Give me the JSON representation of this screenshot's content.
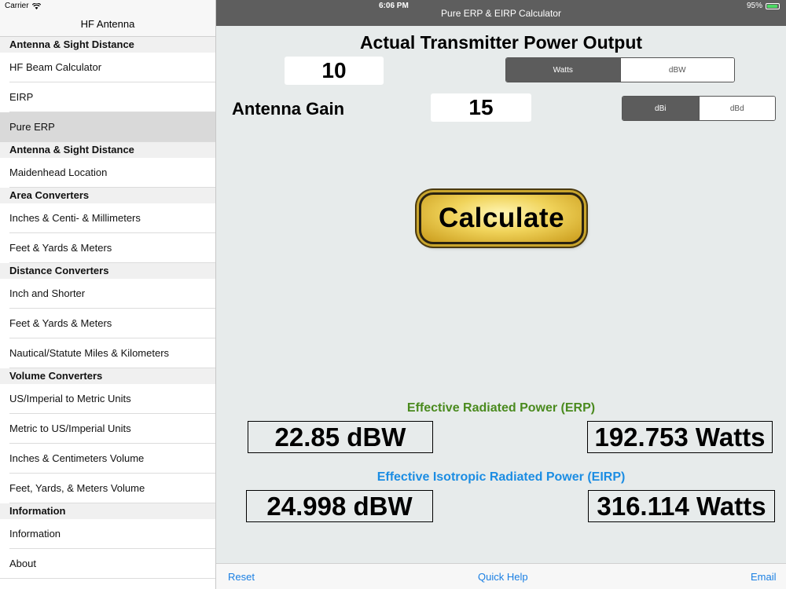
{
  "status": {
    "carrier": "Carrier",
    "time": "6:06 PM",
    "battery": "95%"
  },
  "sidebar": {
    "title": "HF Antenna",
    "sections": [
      {
        "header": "Antenna & Sight Distance",
        "items": [
          "HF Beam Calculator",
          "EIRP",
          "Pure ERP"
        ]
      },
      {
        "header": "Antenna & Sight Distance",
        "items": [
          "Maidenhead Location"
        ]
      },
      {
        "header": "Area Converters",
        "items": [
          "Inches & Centi- & Millimeters",
          "Feet & Yards & Meters"
        ]
      },
      {
        "header": "Distance Converters",
        "items": [
          "Inch and Shorter",
          "Feet & Yards & Meters",
          "Nautical/Statute Miles & Kilometers"
        ]
      },
      {
        "header": "Volume Converters",
        "items": [
          "US/Imperial to Metric Units",
          "Metric to US/Imperial Units",
          "Inches & Centimeters Volume",
          "Feet, Yards, & Meters Volume"
        ]
      },
      {
        "header": "Information",
        "items": [
          "Information",
          "About"
        ]
      }
    ],
    "selected": "Pure ERP"
  },
  "header": {
    "title": "Pure ERP & EIRP Calculator"
  },
  "form": {
    "power_title": "Actual Transmitter Power Output",
    "power_value": "10",
    "power_units": [
      "Watts",
      "dBW"
    ],
    "gain_label": "Antenna Gain",
    "gain_value": "15",
    "gain_units": [
      "dBi",
      "dBd"
    ],
    "calculate_label": "Calculate"
  },
  "results": {
    "erp_title": "Effective Radiated Power (ERP)",
    "erp_dbw": "22.85 dBW",
    "erp_watts": "192.753 Watts",
    "eirp_title": "Effective Isotropic Radiated Power (EIRP)",
    "eirp_dbw": "24.998 dBW",
    "eirp_watts": "316.114 Watts"
  },
  "toolbar": {
    "reset": "Reset",
    "quick_help": "Quick Help",
    "email": "Email"
  },
  "colors": {
    "erp": "#4a8a1e",
    "eirp": "#1c8de3",
    "toolbar_link": "#1a7fe3",
    "nav_bar": "#5e5e5e"
  }
}
